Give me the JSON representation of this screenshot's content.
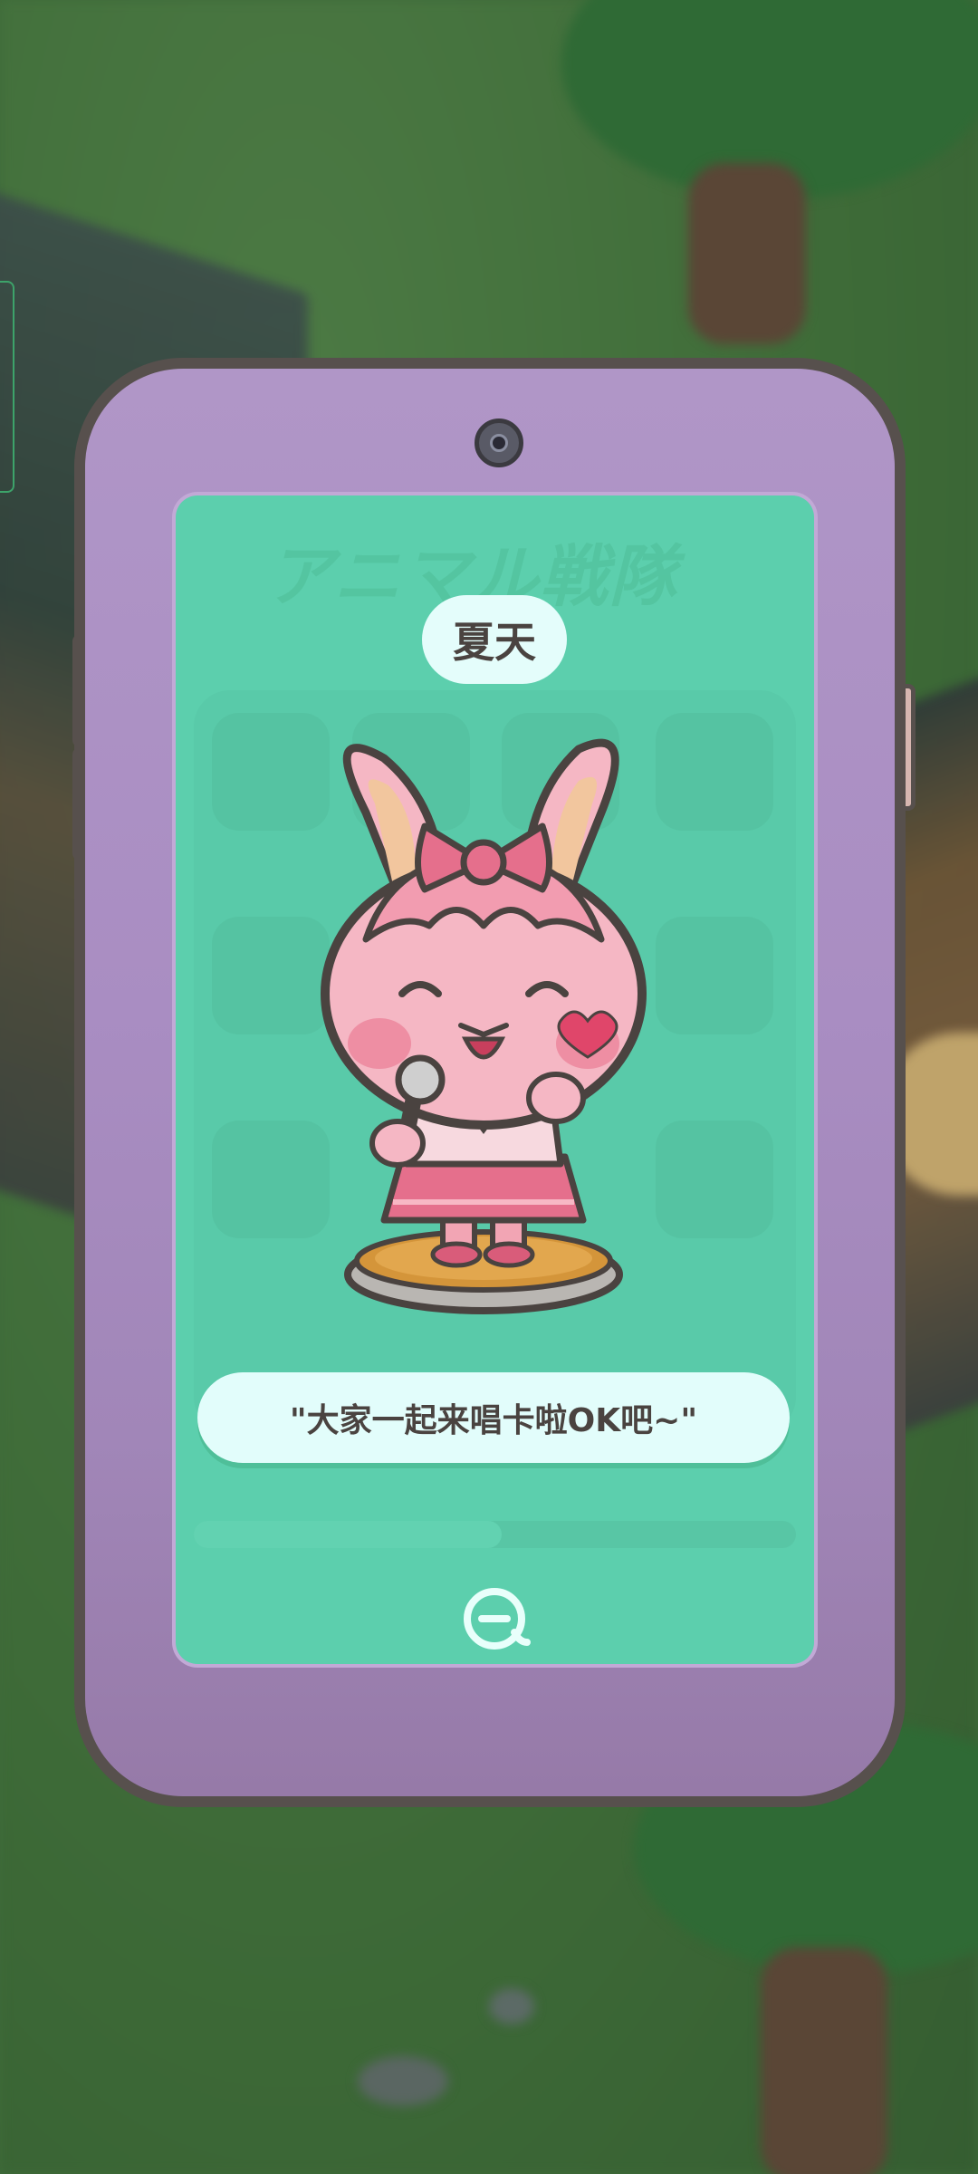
{
  "character": {
    "name": "夏天",
    "quote": "\"大家一起来唱卡啦OK吧~\""
  },
  "watermark_logo": "アニマル戦隊",
  "icons": {
    "camera": "camera-icon",
    "close": "close-icon"
  },
  "colors": {
    "phone_body": "#a98dc2",
    "screen": "#5ccfad",
    "bubble": "#e2fdfb",
    "text": "#4a4340"
  }
}
